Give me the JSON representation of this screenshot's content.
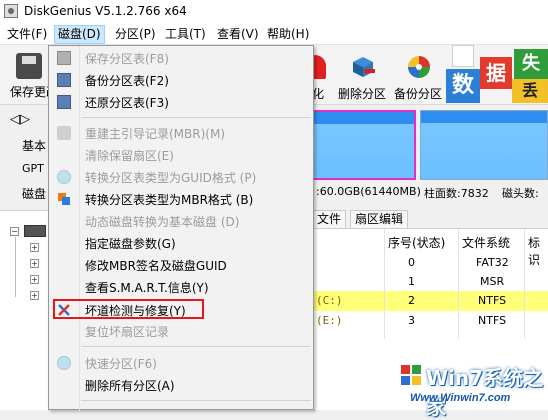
{
  "window": {
    "title": "DiskGenius V5.1.2.766 x64"
  },
  "menubar": [
    {
      "label": "文件(F)"
    },
    {
      "label": "磁盘(D)"
    },
    {
      "label": "分区(P)"
    },
    {
      "label": "工具(T)"
    },
    {
      "label": "查看(V)"
    },
    {
      "label": "帮助(H)"
    }
  ],
  "toolbar": {
    "save_label": "保存更改",
    "format_label": "化",
    "delete_label": "删除分区",
    "backup_label": "备份分区",
    "promo_tiles": [
      "数",
      "据",
      "失",
      "丢"
    ]
  },
  "disk_panel": {
    "nav_prev": "◁",
    "nav_next": "▷",
    "basic": "基本",
    "gpt": "GPT",
    "disk": "磁盘",
    "capacity": ":60.0GB(61440MB)",
    "cylinders": "柱面数:7832",
    "heads": "磁头数:"
  },
  "tabs": [
    "文件",
    "扇区编辑"
  ],
  "table": {
    "headers": [
      "序号(状态)",
      "文件系统",
      "标识"
    ],
    "rows": [
      {
        "vol": "",
        "index": "0",
        "fs": "FAT32"
      },
      {
        "vol": "",
        "index": "1",
        "fs": "MSR"
      },
      {
        "vol": "(C:)",
        "index": "2",
        "fs": "NTFS"
      },
      {
        "vol": "(E:)",
        "index": "3",
        "fs": "NTFS"
      }
    ]
  },
  "dropdown": {
    "items": [
      {
        "label": "保存分区表(F8)",
        "enabled": false
      },
      {
        "label": "备份分区表(F2)",
        "enabled": true
      },
      {
        "label": "还原分区表(F3)",
        "enabled": true
      },
      {
        "label": "重建主引导记录(MBR)(M)",
        "enabled": false
      },
      {
        "label": "清除保留扇区(E)",
        "enabled": false
      },
      {
        "label": "转换分区表类型为GUID格式 (P)",
        "enabled": false
      },
      {
        "label": "转换分区表类型为MBR格式 (B)",
        "enabled": true
      },
      {
        "label": "动态磁盘转换为基本磁盘 (D)",
        "enabled": false
      },
      {
        "label": "指定磁盘参数(G)",
        "enabled": true
      },
      {
        "label": "修改MBR签名及磁盘GUID",
        "enabled": true
      },
      {
        "label": "查看S.M.A.R.T.信息(Y)",
        "enabled": true
      },
      {
        "label": "坏道检测与修复(Y)",
        "enabled": true
      },
      {
        "label": "复位坏扇区记录",
        "enabled": false
      },
      {
        "label": "快速分区(F6)",
        "enabled": false
      },
      {
        "label": "删除所有分区(A)",
        "enabled": true
      }
    ]
  },
  "watermark": {
    "main": "Win7系统之家",
    "url": "Www.Winwin7.com"
  },
  "colors": {
    "highlight": "#e8161c",
    "selected_row": "#ffff7a",
    "partition": "#6cc0ff",
    "partition_border": "#e030c8"
  }
}
